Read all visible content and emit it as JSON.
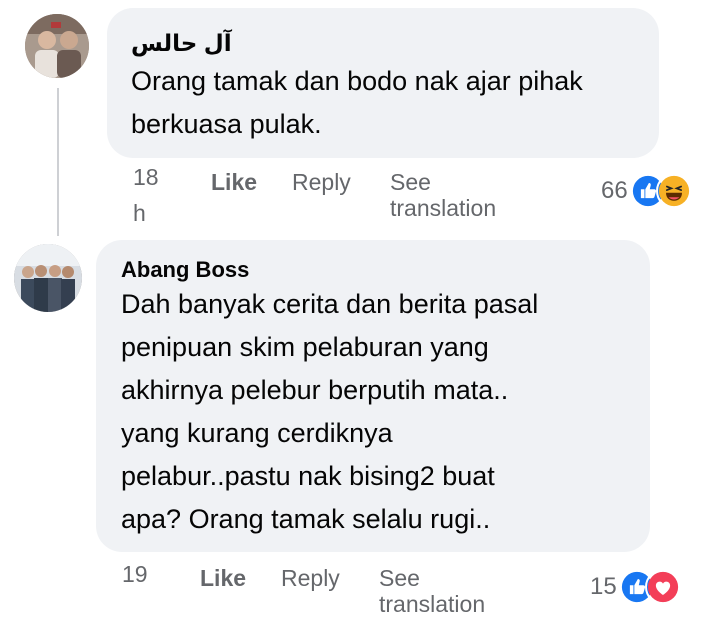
{
  "comments": [
    {
      "author": "آل حالس",
      "text": "Orang tamak dan bodo nak ajar pihak berkuasa pulak.",
      "time_value": "18",
      "time_unit": "h",
      "actions": {
        "like": "Like",
        "reply": "Reply",
        "see": "See",
        "translation": "translation"
      },
      "reaction_count": "66",
      "reaction_icons": [
        "like-icon",
        "haha-icon"
      ]
    },
    {
      "author": "Abang Boss",
      "text_lines": [
        "Dah banyak cerita dan berita pasal",
        "penipuan skim pelaburan yang",
        "akhirnya pelebur berputih mata..",
        "yang kurang cerdiknya",
        "pelabur..pastu nak bising2 buat",
        "apa? Orang tamak selalu rugi.."
      ],
      "time_value": "19",
      "actions": {
        "like": "Like",
        "reply": "Reply",
        "see": "See",
        "translation": "translation"
      },
      "reaction_count": "15",
      "reaction_icons": [
        "like-icon",
        "love-icon"
      ]
    }
  ],
  "colors": {
    "bubble": "#f0f2f5",
    "meta": "#65676b",
    "like_blue": "#1877f2",
    "love_red": "#f33e58",
    "haha_yellow": "#f7b125"
  }
}
